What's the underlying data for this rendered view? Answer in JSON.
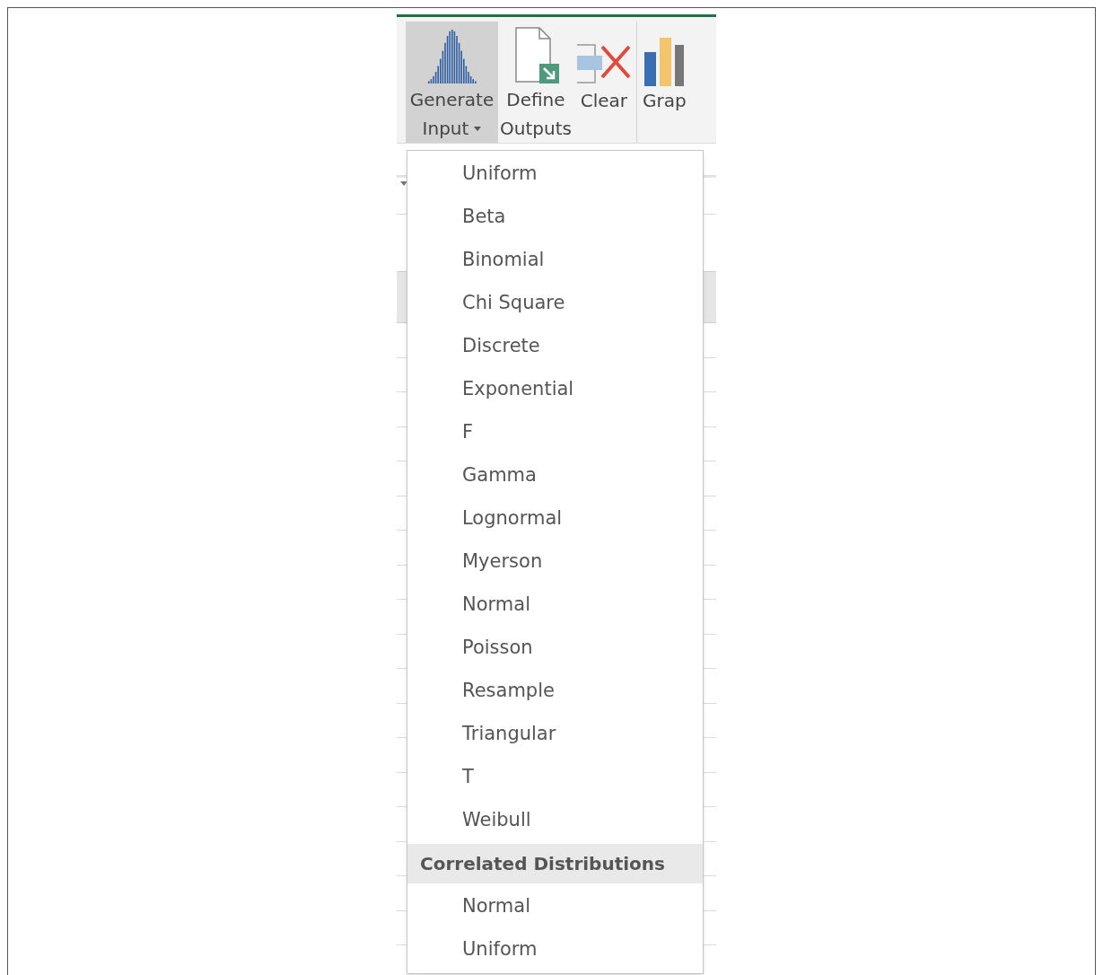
{
  "ribbon": {
    "buttons": [
      {
        "kind": "distribution",
        "label_lines": [
          "Generate",
          "Input"
        ],
        "dropdown": true,
        "pressed": true
      },
      {
        "kind": "document",
        "label_lines": [
          "Define",
          "Outputs"
        ],
        "dropdown": false,
        "pressed": false
      },
      {
        "kind": "clear",
        "label_lines": [
          "Clear"
        ],
        "dropdown": false,
        "pressed": false
      },
      {
        "kind": "chart",
        "label_lines": [
          "Grap"
        ],
        "dropdown": false,
        "pressed": false
      }
    ]
  },
  "menu": {
    "items": [
      {
        "kind": "item",
        "label": "Uniform"
      },
      {
        "kind": "item",
        "label": "Beta"
      },
      {
        "kind": "item",
        "label": "Binomial"
      },
      {
        "kind": "item",
        "label": "Chi Square"
      },
      {
        "kind": "item",
        "label": "Discrete"
      },
      {
        "kind": "item",
        "label": "Exponential"
      },
      {
        "kind": "item",
        "label": "F"
      },
      {
        "kind": "item",
        "label": "Gamma"
      },
      {
        "kind": "item",
        "label": "Lognormal"
      },
      {
        "kind": "item",
        "label": "Myerson"
      },
      {
        "kind": "item",
        "label": "Normal"
      },
      {
        "kind": "item",
        "label": "Poisson"
      },
      {
        "kind": "item",
        "label": "Resample"
      },
      {
        "kind": "item",
        "label": "Triangular"
      },
      {
        "kind": "item",
        "label": "T"
      },
      {
        "kind": "item",
        "label": "Weibull"
      },
      {
        "kind": "header",
        "label": "Correlated Distributions"
      },
      {
        "kind": "item",
        "label": "Normal"
      },
      {
        "kind": "item",
        "label": "Uniform"
      }
    ]
  }
}
